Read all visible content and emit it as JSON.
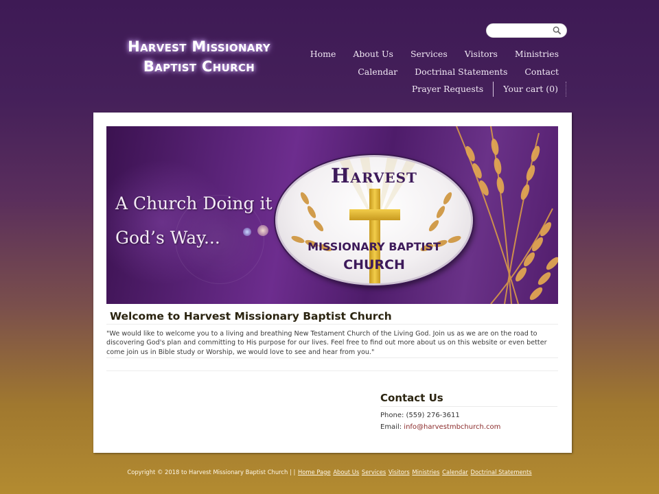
{
  "site": {
    "logo_line1": "Harvest Missionary",
    "logo_line2": "Baptist Church"
  },
  "search": {
    "placeholder": "",
    "value": "",
    "icon": "search-icon"
  },
  "nav": {
    "row1": [
      "Home",
      "About Us",
      "Services",
      "Visitors",
      "Ministries"
    ],
    "row2": [
      "Calendar",
      "Doctrinal Statements",
      "Contact"
    ],
    "row3": [
      "Prayer Requests"
    ],
    "cart_label": "Your cart (0)"
  },
  "banner": {
    "tagline_line1": "A Church Doing it",
    "tagline_line2": "God’s Way...",
    "seal_title": "Harvest",
    "seal_line1": "MISSIONARY BAPTIST",
    "seal_line2": "CHURCH"
  },
  "welcome": {
    "title": "Welcome to Harvest Missionary Baptist Church",
    "body": "\"We would like to welcome you to a living and breathing New Testament Church of the Living God. Join us as we are on the road to discovering God's plan and committing to His purpose for our lives. Feel free to find out more about us on this website or even better come join us in Bible study or Worship, we would love to see and hear from you.\""
  },
  "contact": {
    "title": "Contact Us",
    "phone_label": "Phone: ",
    "phone": "(559) 276-3611",
    "email_label": "Email: ",
    "email": "info@harvestmbchurch.com"
  },
  "footer": {
    "copyright": "Copyright © 2018 to Harvest Missionary Baptist Church | | ",
    "links": [
      "Home Page",
      "About Us",
      "Services",
      "Visitors",
      "Ministries",
      "Calendar",
      "Doctrinal Statements"
    ]
  },
  "colors": {
    "header_purple": "#3e1a55",
    "footer_gold": "#b38b30",
    "email_link": "#8a2a2a"
  }
}
